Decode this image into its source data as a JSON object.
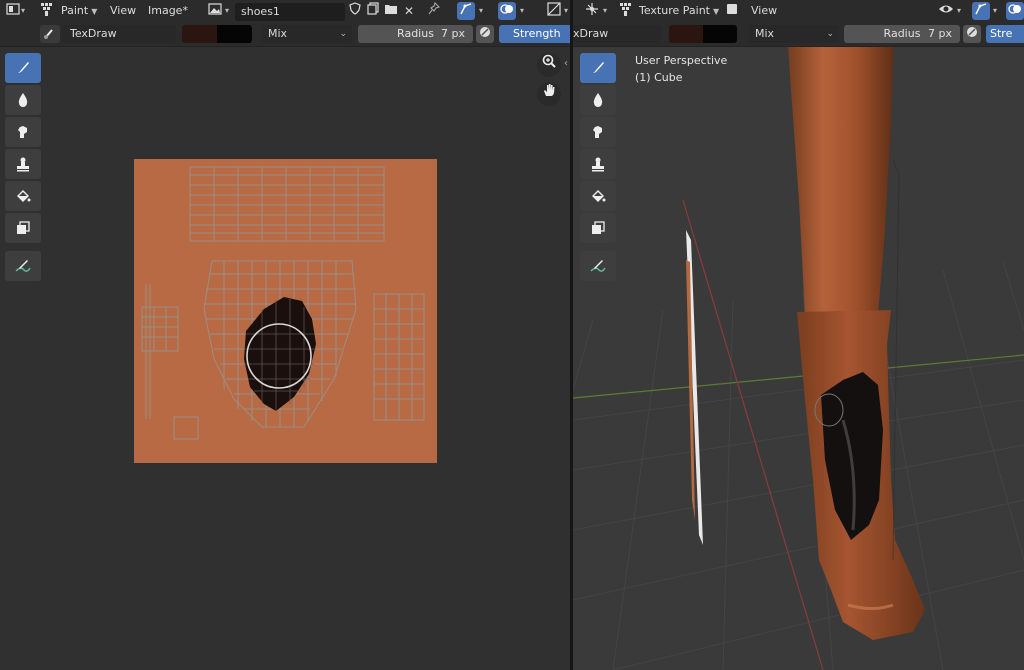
{
  "left_editor": {
    "mode_label": "Paint",
    "menu_view": "View",
    "menu_image": "Image*",
    "image_name": "shoes1",
    "brush_name": "TexDraw",
    "blend_mode": "Mix",
    "radius_label": "Radius",
    "radius_value": "7 px",
    "strength_label": "Strength",
    "colors": {
      "primary": "#2a1510",
      "secondary": "#050505",
      "canvas": "#b86a44",
      "uv_grid": "#9a8e88",
      "brush_circle": "#d8d8d8"
    }
  },
  "right_editor": {
    "mode_label": "Texture Paint",
    "menu_view": "View",
    "brush_name_partial": "xDraw",
    "blend_mode": "Mix",
    "radius_label": "Radius",
    "radius_value": "7 px",
    "strength_label_partial": "Stre",
    "viewport_title": "User Perspective",
    "viewport_object": "(1) Cube",
    "colors": {
      "boot": "#a4502a",
      "grid_x_axis": "#8a3a3a",
      "grid_y_axis": "#6a8a3a"
    }
  },
  "tools": [
    "draw-brush-icon",
    "soften-icon",
    "smear-icon",
    "clone-icon",
    "fill-icon",
    "mask-icon",
    "annotate-icon"
  ],
  "colors": {
    "active_tool": "#4772b3",
    "header_bg": "#2b2b2b",
    "editor_bg": "#303030",
    "viewport_bg": "#3a3a3a"
  }
}
